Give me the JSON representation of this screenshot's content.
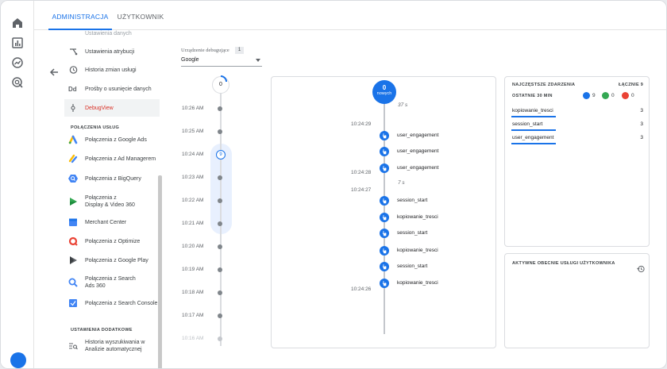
{
  "tabs": [
    {
      "label": "ADMINISTRACJA",
      "active": true
    },
    {
      "label": "UŻYTKOWNIK",
      "active": false
    }
  ],
  "rail": {
    "icons": [
      "home-icon",
      "reports-icon",
      "explore-icon",
      "advertising-icon",
      "help-icon"
    ]
  },
  "nav": {
    "cut_top_label": "Ustawienia danych",
    "items_top": [
      {
        "label": "Ustawienia atrybucji",
        "icon": "attribution-icon"
      },
      {
        "label": "Historia zmian usługi",
        "icon": "history-icon"
      },
      {
        "label": "Prośby o usunięcie danych",
        "icon": "dd-icon"
      },
      {
        "label": "DebugView",
        "icon": "debug-icon",
        "selected": true
      }
    ],
    "section_links": "POŁĄCZENIA USŁUG",
    "items_links": [
      {
        "label": "Połączenia z Google Ads",
        "icon": "google-ads-icon"
      },
      {
        "label": "Połączenia z Ad Managerem",
        "icon": "ad-manager-icon"
      },
      {
        "label": "Połączenia z BigQuery",
        "icon": "bigquery-icon"
      },
      {
        "label": "Połączenia z\nDisplay & Video 360",
        "icon": "dv360-icon"
      },
      {
        "label": "Merchant Center",
        "icon": "merchant-center-icon"
      },
      {
        "label": "Połączenia z Optimize",
        "icon": "optimize-icon"
      },
      {
        "label": "Połączenia z Google Play",
        "icon": "google-play-icon"
      },
      {
        "label": "Połączenia z Search\nAds 360",
        "icon": "search-ads-icon"
      },
      {
        "label": "Połączenia z Search Console",
        "icon": "search-console-icon"
      }
    ],
    "section_extra": "USTAWIENIA DODATKOWE",
    "items_extra": [
      {
        "label": "Historia wyszukiwania w\nAnalizie automatycznej",
        "icon": "search-history-icon"
      }
    ]
  },
  "device": {
    "label": "Urządzenie debugujące",
    "count": "1",
    "selected": "Google"
  },
  "minutes": {
    "top_count": "0",
    "badge_count": "9",
    "rows": [
      "10:26 AM",
      "10:25 AM",
      "10:24 AM",
      "10:23 AM",
      "10:22 AM",
      "10:21 AM",
      "10:20 AM",
      "10:19 AM",
      "10:18 AM",
      "10:17 AM",
      "10:16 AM"
    ]
  },
  "seconds": {
    "top_count": "0",
    "top_label": "nowych",
    "intervals": [
      "37 s",
      "7 s"
    ],
    "times": [
      "10:24:29",
      "10:24:28",
      "10:24:27",
      "10:24:26"
    ],
    "events": [
      "user_engagement",
      "user_engagement",
      "user_engagement",
      "session_start",
      "kopiowanie_tresci",
      "session_start",
      "kopiowanie_tresci",
      "session_start",
      "kopiowanie_tresci"
    ]
  },
  "top_events": {
    "title": "NAJCZĘSTSZE ZDARZENIA",
    "total_label": "ŁĄCZNIE 9",
    "period": "OSTATNIE 30 MIN",
    "stats": [
      {
        "value": "9",
        "color": "#1a73e8",
        "icon": "event-icon"
      },
      {
        "value": "0",
        "color": "#34a853",
        "icon": "conversion-icon"
      },
      {
        "value": "0",
        "color": "#ea4335",
        "icon": "error-icon"
      }
    ],
    "rows": [
      {
        "name": "kopiowanie_tresci",
        "count": "3"
      },
      {
        "name": "session_start",
        "count": "3"
      },
      {
        "name": "user_engagement",
        "count": "3"
      }
    ]
  },
  "user_props": {
    "title": "AKTYWNE OBECNIE USŁUGI UŻYTKOWNIKA"
  }
}
